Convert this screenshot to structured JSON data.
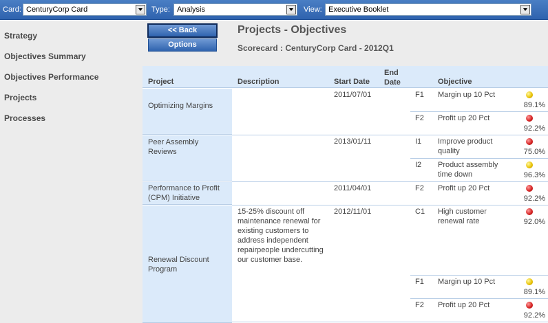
{
  "topbar": {
    "card_label": "Card:",
    "card_value": "CenturyCorp Card",
    "type_label": "Type:",
    "type_value": "Analysis",
    "view_label": "View:",
    "view_value": "Executive Booklet"
  },
  "sidebar": {
    "items": [
      {
        "label": "Strategy"
      },
      {
        "label": "Objectives Summary"
      },
      {
        "label": "Objectives Performance"
      },
      {
        "label": "Projects"
      },
      {
        "label": "Processes"
      }
    ]
  },
  "main": {
    "back_label": "<< Back",
    "options_label": "Options",
    "title": "Projects - Objectives",
    "scorecard": "Scorecard : CenturyCorp Card - 2012Q1"
  },
  "table": {
    "headers": {
      "project": "Project",
      "description": "Description",
      "start_date": "Start Date",
      "end_date": "End Date",
      "objective": "Objective"
    },
    "projects": [
      {
        "name": "Optimizing Margins",
        "description": "",
        "start_date": "2011/07/01",
        "end_date": "",
        "objectives": [
          {
            "code": "F1",
            "name": "Margin up 10 Pct",
            "status": "yellow",
            "value": "89.1%"
          },
          {
            "code": "F2",
            "name": "Profit up 20 Pct",
            "status": "red",
            "value": "92.2%"
          }
        ]
      },
      {
        "name": "Peer Assembly Reviews",
        "description": "",
        "start_date": "2013/01/11",
        "end_date": "",
        "objectives": [
          {
            "code": "I1",
            "name": "Improve product quality",
            "status": "red",
            "value": "75.0%"
          },
          {
            "code": "I2",
            "name": "Product assembly time down",
            "status": "yellow",
            "value": "96.3%"
          }
        ]
      },
      {
        "name": "Performance to Profit (CPM) Initiative",
        "description": "",
        "start_date": "2011/04/01",
        "end_date": "",
        "objectives": [
          {
            "code": "F2",
            "name": "Profit up 20 Pct",
            "status": "red",
            "value": "92.2%"
          }
        ]
      },
      {
        "name": "Renewal Discount Program",
        "description": "15-25% discount off maintenance renewal for existing customers to address independent repairpeople undercutting our customer base.",
        "start_date": "2012/11/01",
        "end_date": "",
        "objectives": [
          {
            "code": "C1",
            "name": "High customer renewal rate",
            "status": "red",
            "value": "92.0%"
          },
          {
            "code": "F1",
            "name": "Margin up 10 Pct",
            "status": "yellow",
            "value": "89.1%"
          },
          {
            "code": "F2",
            "name": "Profit up 20 Pct",
            "status": "red",
            "value": "92.2%"
          }
        ]
      }
    ]
  },
  "colors": {
    "topbar": "#2f63ae",
    "header_bg": "#dbeafa",
    "sidebar_bg": "#ececec",
    "status_yellow": "#e8c000",
    "status_red": "#d42020"
  }
}
